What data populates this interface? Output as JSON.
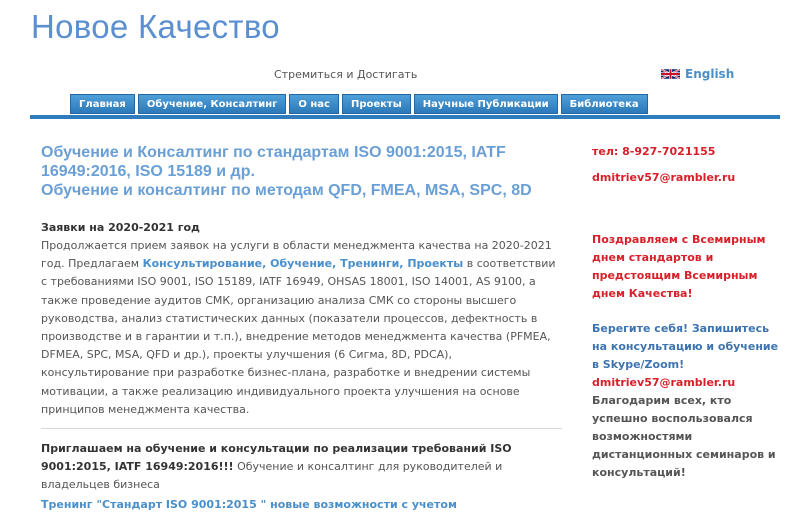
{
  "header": {
    "site_title": "Новое Качество",
    "tagline": "Стремиться и Достигать",
    "language_link": "English"
  },
  "nav": {
    "items": [
      {
        "label": "Главная"
      },
      {
        "label": "Обучение, Консалтинг"
      },
      {
        "label": "О нас"
      },
      {
        "label": "Проекты"
      },
      {
        "label": "Научные Публикации"
      },
      {
        "label": "Библиотека"
      }
    ]
  },
  "main": {
    "heading_line1": "Обучение и Консалтинг по стандартам ISO 9001:2015, IATF 16949:2016, ISO 15189 и др.",
    "heading_line2": "Обучение и консалтинг по методам QFD, FMEA, MSA, SPC, 8D",
    "section_title": "Заявки на 2020-2021 год",
    "para_part1": "Продолжается прием заявок на услуги в области менеджмента качества на 2020-2021 год. Предлагаем ",
    "para_link": "Консультирование, Обучение, Тренинги, Проекты",
    "para_part2": " в соответствии с требованиями ISO 9001, ISO 15189, IATF 16949, OHSAS 18001, ISO 14001, AS 9100, а также проведение аудитов СМК, организацию анализа СМК со стороны высшего руководства, анализ статистических данных (показатели процессов, дефектность в производстве и в гарантии и т.п.), внедрение методов менеджмента качества (PFMEA, DFMEA, SPC, MSA, QFD и др.), проекты улучшения (6 Сигма, 8D, PDCA), консультирование при разработке бизнес-плана, разработке и внедрении системы мотивации, а также реализацию индивидуального проекта улучшения на основе принципов менеджмента качества.",
    "invite_bold": "Приглашаем на обучение и консультации по реализации требований ISO 9001:2015, IATF 16949:2016!!!",
    "invite_rest": " Обучение и консалтинг для руководителей и владельцев бизнеса",
    "training_link": "Тренинг \"Стандарт ISO 9001:2015 \" новые возможности с учетом"
  },
  "sidebar": {
    "phone": "тел: 8-927-7021155",
    "email": "dmitriev57@rambler.ru",
    "congrats": "Поздравляем с Всемирным днем стандартов и предстоящим Всемирным днем Качества!",
    "care": "Берегите себя! Запишитесь на консультацию и обучение в Skype/Zoom!",
    "email2": "dmitriev57@rambler.ru",
    "thanks": "Благодарим всех, кто успешно воспользовался возможностями дистанционных семинаров и консультаций!"
  },
  "colors": {
    "title_blue": "#5b8fd0",
    "nav_blue": "#2f7cbd",
    "link_blue": "#4a8fcb",
    "accent_red": "#d8202a"
  },
  "icons": {
    "language_flag": "uk-flag-icon"
  }
}
